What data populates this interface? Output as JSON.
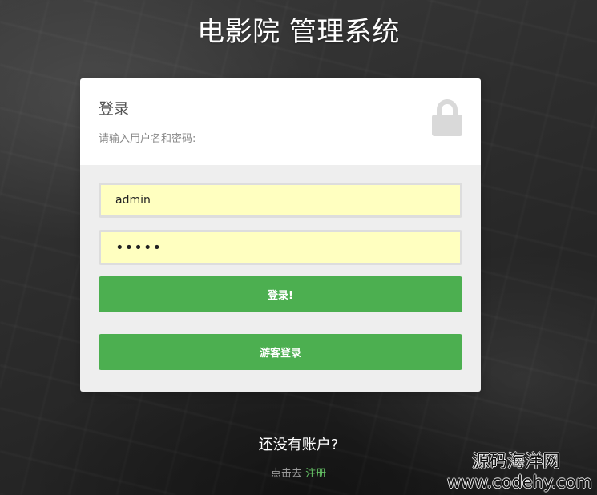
{
  "page": {
    "title": "电影院 管理系统"
  },
  "login_panel": {
    "title": "登录",
    "subtitle": "请输入用户名和密码:",
    "lock_icon": "lock-icon"
  },
  "form": {
    "username_value": "admin",
    "password_value": "•••••",
    "login_button": "登录!",
    "guest_button": "游客登录"
  },
  "footer": {
    "no_account": "还没有账户?",
    "register_prefix": "点击去 ",
    "register_link": "注册"
  },
  "watermark": {
    "line1": "源码海洋网",
    "line2": "www.codehy.com"
  },
  "colors": {
    "accent": "#4caf50",
    "input_bg": "#ffffc0",
    "panel_body": "#eeeeee",
    "link": "#66c266"
  }
}
